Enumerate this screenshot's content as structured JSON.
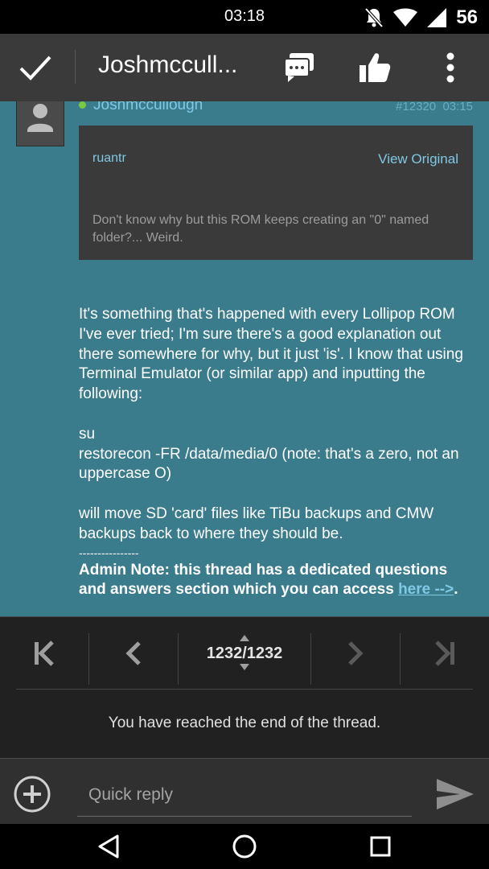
{
  "status_bar": {
    "time": "03:18",
    "battery": "56",
    "icons": [
      "notifications-off-icon",
      "wifi-icon",
      "signal-icon"
    ]
  },
  "action_bar": {
    "title": "Joshmccull...",
    "icons": [
      "check-icon",
      "chat-bubbles-icon",
      "thumbs-up-icon",
      "overflow-menu-icon"
    ]
  },
  "post": {
    "author": "Joshmccullough",
    "post_number": "#12320",
    "time": "03:15",
    "quote": {
      "author": "ruantr",
      "view_original": "View Original",
      "text": "Don't know why but this ROM keeps creating an \"0\" named folder?... Weird."
    },
    "body": {
      "paragraph1": "It's something that's happened with every Lollipop ROM I've ever tried; I'm sure there's a good explanation out there somewhere for why, but it just 'is'. I know that using Terminal Emulator (or similar app) and inputting the following:",
      "code_line1": "su",
      "code_line2": "restorecon -FR /data/media/0 (note: that's a zero, not an uppercase O)",
      "paragraph2": "will move SD 'card' files like TiBu backups and CMW backups back to where they should be.",
      "divider": "----------------",
      "admin_note": "Admin Note: this thread has a dedicated questions and answers section which you can access ",
      "admin_link": "here -->",
      "admin_end": "."
    }
  },
  "pagination": {
    "current": "1232",
    "total": "1232",
    "label": "1232/1232",
    "end_message": "You have reached the end of the thread."
  },
  "quick_reply": {
    "placeholder": "Quick reply"
  },
  "colors": {
    "content_bg": "#3a7b8c",
    "action_bar_bg": "#3a3a3a",
    "link": "#7fc9e4",
    "online": "#7ac943"
  }
}
